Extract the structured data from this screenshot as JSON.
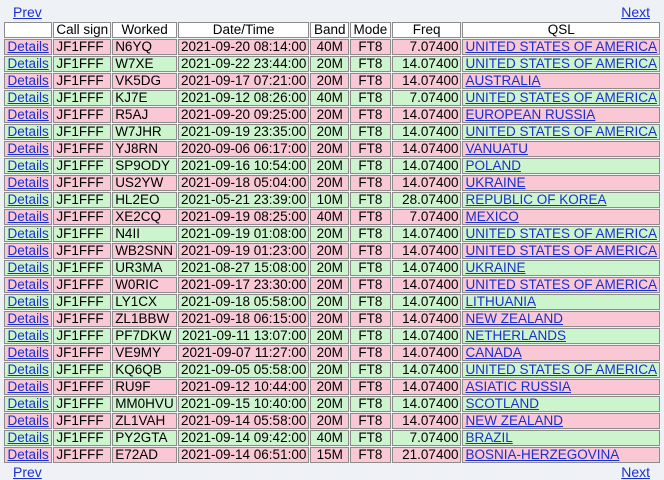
{
  "nav": {
    "prev": "Prev",
    "next": "Next"
  },
  "headers": [
    "",
    "Call sign",
    "Worked",
    "Date/Time",
    "Band",
    "Mode",
    "Freq",
    "QSL"
  ],
  "details_label": "Details",
  "rows": [
    {
      "shade": "pink",
      "call": "JF1FFF",
      "worked": "N6YQ",
      "datetime": "2021-09-20 08:14:00",
      "band": "40M",
      "mode": "FT8",
      "freq": "7.07400",
      "qsl": "UNITED STATES OF AMERICA"
    },
    {
      "shade": "green",
      "call": "JF1FFF",
      "worked": "W7XE",
      "datetime": "2021-09-22 23:44:00",
      "band": "20M",
      "mode": "FT8",
      "freq": "14.07400",
      "qsl": "UNITED STATES OF AMERICA"
    },
    {
      "shade": "pink",
      "call": "JF1FFF",
      "worked": "VK5DG",
      "datetime": "2021-09-17 07:21:00",
      "band": "20M",
      "mode": "FT8",
      "freq": "14.07400",
      "qsl": "AUSTRALIA"
    },
    {
      "shade": "green",
      "call": "JF1FFF",
      "worked": "KJ7E",
      "datetime": "2021-09-12 08:26:00",
      "band": "40M",
      "mode": "FT8",
      "freq": "7.07400",
      "qsl": "UNITED STATES OF AMERICA"
    },
    {
      "shade": "pink",
      "call": "JF1FFF",
      "worked": "R5AJ",
      "datetime": "2021-09-20 09:25:00",
      "band": "20M",
      "mode": "FT8",
      "freq": "14.07400",
      "qsl": "EUROPEAN RUSSIA"
    },
    {
      "shade": "green",
      "call": "JF1FFF",
      "worked": "W7JHR",
      "datetime": "2021-09-19 23:35:00",
      "band": "20M",
      "mode": "FT8",
      "freq": "14.07400",
      "qsl": "UNITED STATES OF AMERICA"
    },
    {
      "shade": "pink",
      "call": "JF1FFF",
      "worked": "YJ8RN",
      "datetime": "2020-09-06 06:17:00",
      "band": "20M",
      "mode": "FT8",
      "freq": "14.07400",
      "qsl": "VANUATU"
    },
    {
      "shade": "green",
      "call": "JF1FFF",
      "worked": "SP9ODY",
      "datetime": "2021-09-16 10:54:00",
      "band": "20M",
      "mode": "FT8",
      "freq": "14.07400",
      "qsl": "POLAND"
    },
    {
      "shade": "pink",
      "call": "JF1FFF",
      "worked": "US2YW",
      "datetime": "2021-09-18 05:04:00",
      "band": "20M",
      "mode": "FT8",
      "freq": "14.07400",
      "qsl": "UKRAINE"
    },
    {
      "shade": "green",
      "call": "JF1FFF",
      "worked": "HL2EO",
      "datetime": "2021-05-21 23:39:00",
      "band": "10M",
      "mode": "FT8",
      "freq": "28.07400",
      "qsl": "REPUBLIC OF KOREA"
    },
    {
      "shade": "pink",
      "call": "JF1FFF",
      "worked": "XE2CQ",
      "datetime": "2021-09-19 08:25:00",
      "band": "40M",
      "mode": "FT8",
      "freq": "7.07400",
      "qsl": "MEXICO"
    },
    {
      "shade": "green",
      "call": "JF1FFF",
      "worked": "N4II",
      "datetime": "2021-09-19 01:08:00",
      "band": "20M",
      "mode": "FT8",
      "freq": "14.07400",
      "qsl": "UNITED STATES OF AMERICA"
    },
    {
      "shade": "pink",
      "call": "JF1FFF",
      "worked": "WB2SNN",
      "datetime": "2021-09-19 01:23:00",
      "band": "20M",
      "mode": "FT8",
      "freq": "14.07400",
      "qsl": "UNITED STATES OF AMERICA"
    },
    {
      "shade": "green",
      "call": "JF1FFF",
      "worked": "UR3MA",
      "datetime": "2021-08-27 15:08:00",
      "band": "20M",
      "mode": "FT8",
      "freq": "14.07400",
      "qsl": "UKRAINE"
    },
    {
      "shade": "pink",
      "call": "JF1FFF",
      "worked": "W0RIC",
      "datetime": "2021-09-17 23:30:00",
      "band": "20M",
      "mode": "FT8",
      "freq": "14.07400",
      "qsl": "UNITED STATES OF AMERICA"
    },
    {
      "shade": "green",
      "call": "JF1FFF",
      "worked": "LY1CX",
      "datetime": "2021-09-18 05:58:00",
      "band": "20M",
      "mode": "FT8",
      "freq": "14.07400",
      "qsl": "LITHUANIA"
    },
    {
      "shade": "pink",
      "call": "JF1FFF",
      "worked": "ZL1BBW",
      "datetime": "2021-09-18 06:15:00",
      "band": "20M",
      "mode": "FT8",
      "freq": "14.07400",
      "qsl": "NEW ZEALAND"
    },
    {
      "shade": "green",
      "call": "JF1FFF",
      "worked": "PF7DKW",
      "datetime": "2021-09-11 13:07:00",
      "band": "20M",
      "mode": "FT8",
      "freq": "14.07400",
      "qsl": "NETHERLANDS"
    },
    {
      "shade": "pink",
      "call": "JF1FFF",
      "worked": "VE9MY",
      "datetime": "2021-09-07 11:27:00",
      "band": "20M",
      "mode": "FT8",
      "freq": "14.07400",
      "qsl": "CANADA"
    },
    {
      "shade": "green",
      "call": "JF1FFF",
      "worked": "KQ6QB",
      "datetime": "2021-09-05 05:58:00",
      "band": "20M",
      "mode": "FT8",
      "freq": "14.07400",
      "qsl": "UNITED STATES OF AMERICA"
    },
    {
      "shade": "pink",
      "call": "JF1FFF",
      "worked": "RU9F",
      "datetime": "2021-09-12 10:44:00",
      "band": "20M",
      "mode": "FT8",
      "freq": "14.07400",
      "qsl": "ASIATIC RUSSIA"
    },
    {
      "shade": "green",
      "call": "JF1FFF",
      "worked": "MM0HVU",
      "datetime": "2021-09-15 10:40:00",
      "band": "20M",
      "mode": "FT8",
      "freq": "14.07400",
      "qsl": "SCOTLAND"
    },
    {
      "shade": "pink",
      "call": "JF1FFF",
      "worked": "ZL1VAH",
      "datetime": "2021-09-14 05:58:00",
      "band": "20M",
      "mode": "FT8",
      "freq": "14.07400",
      "qsl": "NEW ZEALAND"
    },
    {
      "shade": "green",
      "call": "JF1FFF",
      "worked": "PY2GTA",
      "datetime": "2021-09-14 09:42:00",
      "band": "40M",
      "mode": "FT8",
      "freq": "7.07400",
      "qsl": "BRAZIL"
    },
    {
      "shade": "pink",
      "call": "JF1FFF",
      "worked": "E72AD",
      "datetime": "2021-09-14 06:51:00",
      "band": "15M",
      "mode": "FT8",
      "freq": "21.07400",
      "qsl": "BOSNIA-HERZEGOVINA"
    }
  ],
  "colors": {
    "pink_row": "#fac7d4",
    "green_row": "#cdf5cd",
    "link": "#1a2fd0",
    "page_bg": "#eef2f7"
  }
}
